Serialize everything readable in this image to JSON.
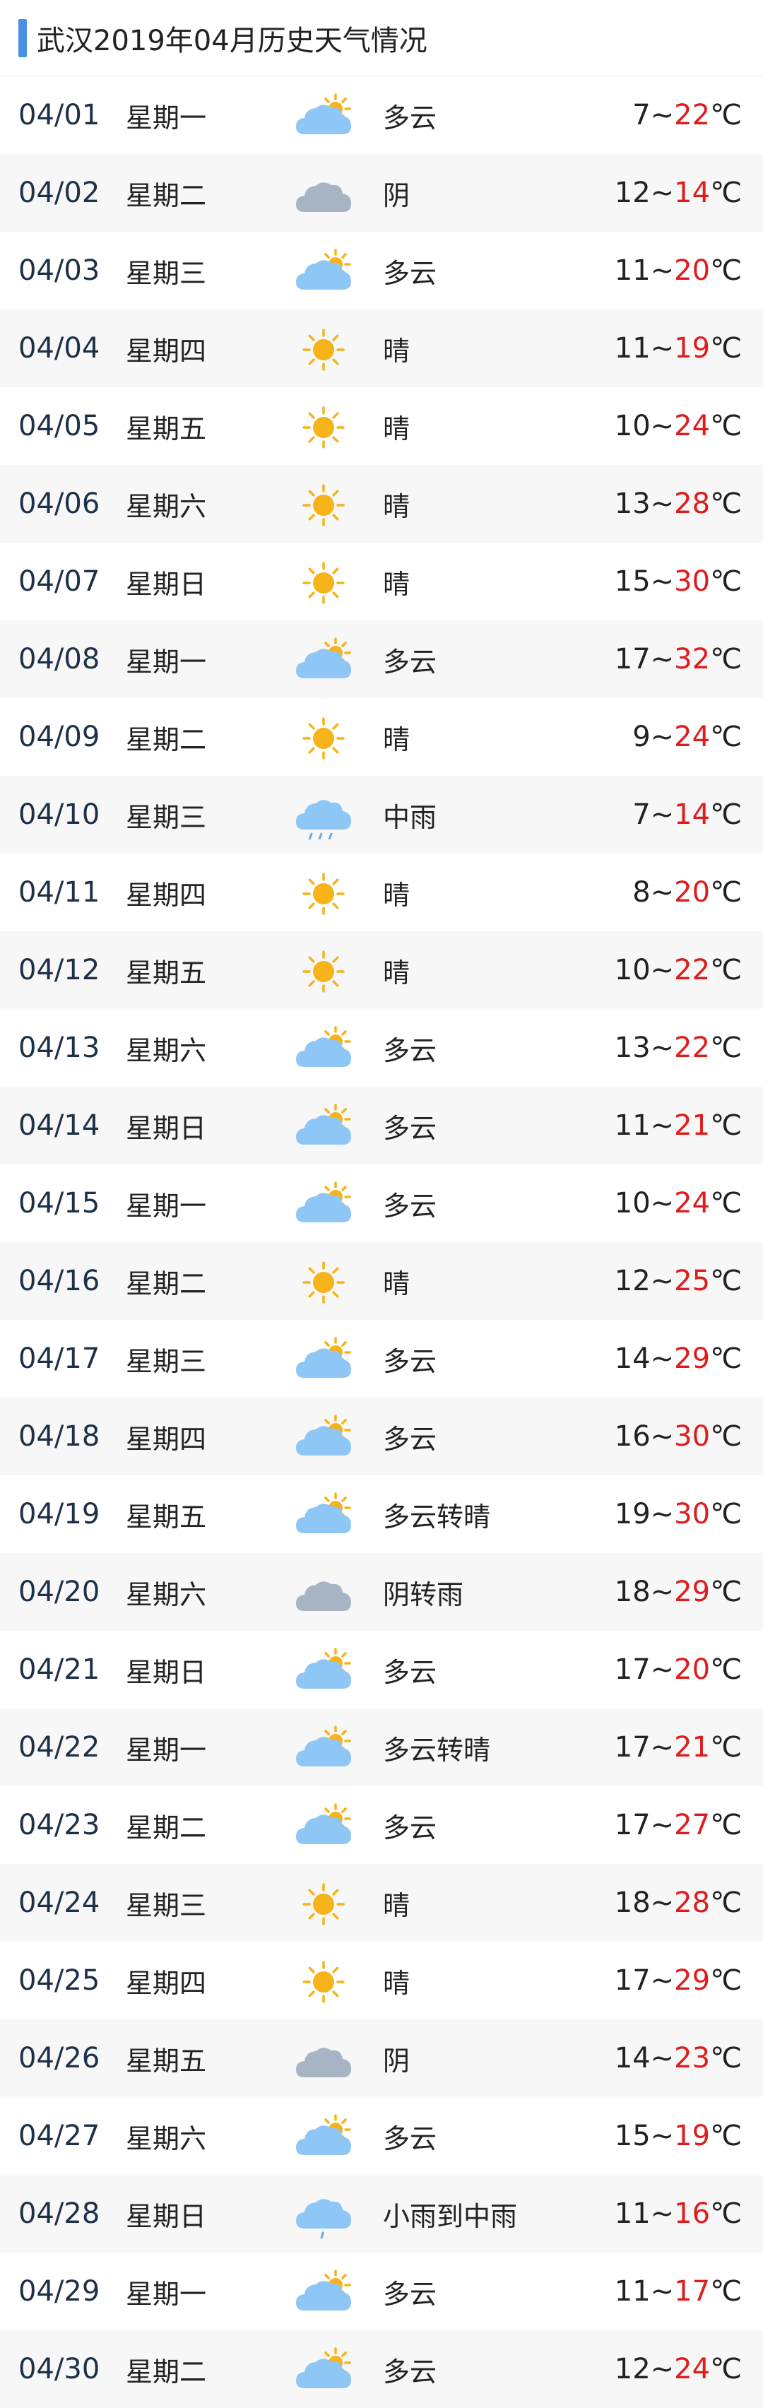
{
  "title": "武汉2019年04月历史天气情况",
  "colors": {
    "accent": "#4a90e2",
    "high_temp": "#e01b1b",
    "sun": "#f6b31a",
    "cloud_light": "#8ec7f6",
    "cloud_dark": "#a6b4c4",
    "rain": "#6fa8dc"
  },
  "rows": [
    {
      "date": "04/01",
      "weekday": "星期一",
      "icon": "partly-cloudy-icon",
      "condition": "多云",
      "low": "7",
      "sep": "~",
      "high": "22",
      "unit": "℃"
    },
    {
      "date": "04/02",
      "weekday": "星期二",
      "icon": "overcast-icon",
      "condition": "阴",
      "low": "12",
      "sep": "~",
      "high": "14",
      "unit": "℃"
    },
    {
      "date": "04/03",
      "weekday": "星期三",
      "icon": "partly-cloudy-icon",
      "condition": "多云",
      "low": "11",
      "sep": "~",
      "high": "20",
      "unit": "℃"
    },
    {
      "date": "04/04",
      "weekday": "星期四",
      "icon": "sunny-icon",
      "condition": "晴",
      "low": "11",
      "sep": "~",
      "high": "19",
      "unit": "℃"
    },
    {
      "date": "04/05",
      "weekday": "星期五",
      "icon": "sunny-icon",
      "condition": "晴",
      "low": "10",
      "sep": "~",
      "high": "24",
      "unit": "℃"
    },
    {
      "date": "04/06",
      "weekday": "星期六",
      "icon": "sunny-icon",
      "condition": "晴",
      "low": "13",
      "sep": "~",
      "high": "28",
      "unit": "℃"
    },
    {
      "date": "04/07",
      "weekday": "星期日",
      "icon": "sunny-icon",
      "condition": "晴",
      "low": "15",
      "sep": "~",
      "high": "30",
      "unit": "℃"
    },
    {
      "date": "04/08",
      "weekday": "星期一",
      "icon": "partly-cloudy-icon",
      "condition": "多云",
      "low": "17",
      "sep": "~",
      "high": "32",
      "unit": "℃"
    },
    {
      "date": "04/09",
      "weekday": "星期二",
      "icon": "sunny-icon",
      "condition": "晴",
      "low": "9",
      "sep": "~",
      "high": "24",
      "unit": "℃"
    },
    {
      "date": "04/10",
      "weekday": "星期三",
      "icon": "moderate-rain-icon",
      "condition": "中雨",
      "low": "7",
      "sep": "~",
      "high": "14",
      "unit": "℃"
    },
    {
      "date": "04/11",
      "weekday": "星期四",
      "icon": "sunny-icon",
      "condition": "晴",
      "low": "8",
      "sep": "~",
      "high": "20",
      "unit": "℃"
    },
    {
      "date": "04/12",
      "weekday": "星期五",
      "icon": "sunny-icon",
      "condition": "晴",
      "low": "10",
      "sep": "~",
      "high": "22",
      "unit": "℃"
    },
    {
      "date": "04/13",
      "weekday": "星期六",
      "icon": "partly-cloudy-icon",
      "condition": "多云",
      "low": "13",
      "sep": "~",
      "high": "22",
      "unit": "℃"
    },
    {
      "date": "04/14",
      "weekday": "星期日",
      "icon": "partly-cloudy-icon",
      "condition": "多云",
      "low": "11",
      "sep": "~",
      "high": "21",
      "unit": "℃"
    },
    {
      "date": "04/15",
      "weekday": "星期一",
      "icon": "partly-cloudy-icon",
      "condition": "多云",
      "low": "10",
      "sep": "~",
      "high": "24",
      "unit": "℃"
    },
    {
      "date": "04/16",
      "weekday": "星期二",
      "icon": "sunny-icon",
      "condition": "晴",
      "low": "12",
      "sep": "~",
      "high": "25",
      "unit": "℃"
    },
    {
      "date": "04/17",
      "weekday": "星期三",
      "icon": "partly-cloudy-icon",
      "condition": "多云",
      "low": "14",
      "sep": "~",
      "high": "29",
      "unit": "℃"
    },
    {
      "date": "04/18",
      "weekday": "星期四",
      "icon": "partly-cloudy-icon",
      "condition": "多云",
      "low": "16",
      "sep": "~",
      "high": "30",
      "unit": "℃"
    },
    {
      "date": "04/19",
      "weekday": "星期五",
      "icon": "partly-cloudy-icon",
      "condition": "多云转晴",
      "low": "19",
      "sep": "~",
      "high": "30",
      "unit": "℃"
    },
    {
      "date": "04/20",
      "weekday": "星期六",
      "icon": "overcast-icon",
      "condition": "阴转雨",
      "low": "18",
      "sep": "~",
      "high": "29",
      "unit": "℃"
    },
    {
      "date": "04/21",
      "weekday": "星期日",
      "icon": "partly-cloudy-icon",
      "condition": "多云",
      "low": "17",
      "sep": "~",
      "high": "20",
      "unit": "℃"
    },
    {
      "date": "04/22",
      "weekday": "星期一",
      "icon": "partly-cloudy-icon",
      "condition": "多云转晴",
      "low": "17",
      "sep": "~",
      "high": "21",
      "unit": "℃"
    },
    {
      "date": "04/23",
      "weekday": "星期二",
      "icon": "partly-cloudy-icon",
      "condition": "多云",
      "low": "17",
      "sep": "~",
      "high": "27",
      "unit": "℃"
    },
    {
      "date": "04/24",
      "weekday": "星期三",
      "icon": "sunny-icon",
      "condition": "晴",
      "low": "18",
      "sep": "~",
      "high": "28",
      "unit": "℃"
    },
    {
      "date": "04/25",
      "weekday": "星期四",
      "icon": "sunny-icon",
      "condition": "晴",
      "low": "17",
      "sep": "~",
      "high": "29",
      "unit": "℃"
    },
    {
      "date": "04/26",
      "weekday": "星期五",
      "icon": "overcast-icon",
      "condition": "阴",
      "low": "14",
      "sep": "~",
      "high": "23",
      "unit": "℃"
    },
    {
      "date": "04/27",
      "weekday": "星期六",
      "icon": "partly-cloudy-icon",
      "condition": "多云",
      "low": "15",
      "sep": "~",
      "high": "19",
      "unit": "℃"
    },
    {
      "date": "04/28",
      "weekday": "星期日",
      "icon": "light-rain-icon",
      "condition": "小雨到中雨",
      "low": "11",
      "sep": "~",
      "high": "16",
      "unit": "℃"
    },
    {
      "date": "04/29",
      "weekday": "星期一",
      "icon": "partly-cloudy-icon",
      "condition": "多云",
      "low": "11",
      "sep": "~",
      "high": "17",
      "unit": "℃"
    },
    {
      "date": "04/30",
      "weekday": "星期二",
      "icon": "partly-cloudy-icon",
      "condition": "多云",
      "low": "12",
      "sep": "~",
      "high": "24",
      "unit": "℃"
    }
  ]
}
